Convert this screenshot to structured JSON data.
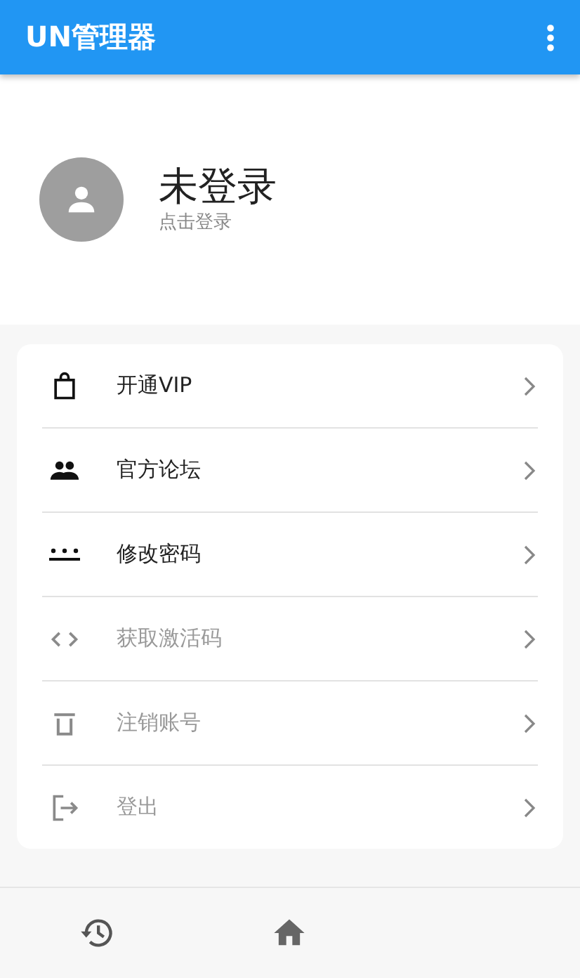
{
  "app_bar": {
    "title": "UN管理器"
  },
  "profile": {
    "name": "未登录",
    "hint": "点击登录"
  },
  "menu": [
    {
      "kind": "bag",
      "label": "开通VIP",
      "disabled": false
    },
    {
      "kind": "people",
      "label": "官方论坛",
      "disabled": false
    },
    {
      "kind": "password",
      "label": "修改密码",
      "disabled": false
    },
    {
      "kind": "code",
      "label": "获取激活码",
      "disabled": true
    },
    {
      "kind": "trash",
      "label": "注销账号",
      "disabled": true
    },
    {
      "kind": "logout",
      "label": "登出",
      "disabled": true
    }
  ],
  "bottom_nav": [
    {
      "kind": "history"
    },
    {
      "kind": "home"
    }
  ]
}
